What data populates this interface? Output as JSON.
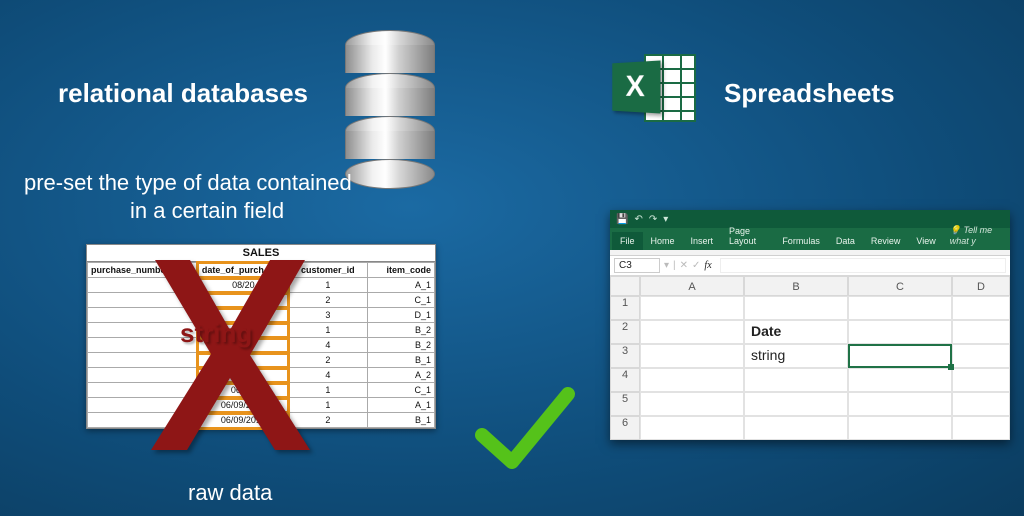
{
  "left": {
    "title": "relational databases",
    "subtitle_line1": "pre-set the type of data contained",
    "subtitle_line2": "in a certain field",
    "caption": "raw data",
    "overlay_word": "string"
  },
  "right": {
    "title": "Spreadsheets",
    "excel_tile_letter": "X"
  },
  "sales_table": {
    "title": "SALES",
    "headers": [
      "purchase_number",
      "date_of_purch",
      "customer_id",
      "item_code"
    ],
    "rows": [
      [
        "",
        "08/20",
        "1",
        "A_1"
      ],
      [
        "",
        "",
        "2",
        "C_1"
      ],
      [
        "",
        "",
        "3",
        "D_1"
      ],
      [
        "",
        "",
        "1",
        "B_2"
      ],
      [
        "",
        "",
        "4",
        "B_2"
      ],
      [
        "",
        "",
        "2",
        "B_1"
      ],
      [
        "",
        "09/",
        "4",
        "A_2"
      ],
      [
        "",
        "06/09/",
        "1",
        "C_1"
      ],
      [
        "",
        "06/09/2017",
        "1",
        "A_1"
      ],
      [
        "",
        "06/09/2017",
        "2",
        "B_1"
      ]
    ]
  },
  "excel_window": {
    "tabs": [
      "File",
      "Home",
      "Insert",
      "Page Layout",
      "Formulas",
      "Data",
      "Review",
      "View"
    ],
    "tell_me": "Tell me what y",
    "cell_ref": "C3",
    "fx_label": "fx",
    "col_headers": [
      "A",
      "B",
      "C",
      "D"
    ],
    "row_headers": [
      "1",
      "2",
      "3",
      "4",
      "5",
      "6"
    ],
    "cells": {
      "B2": "Date",
      "B3": "string"
    }
  },
  "qat_icons": [
    "save-icon",
    "undo-icon",
    "redo-icon"
  ]
}
